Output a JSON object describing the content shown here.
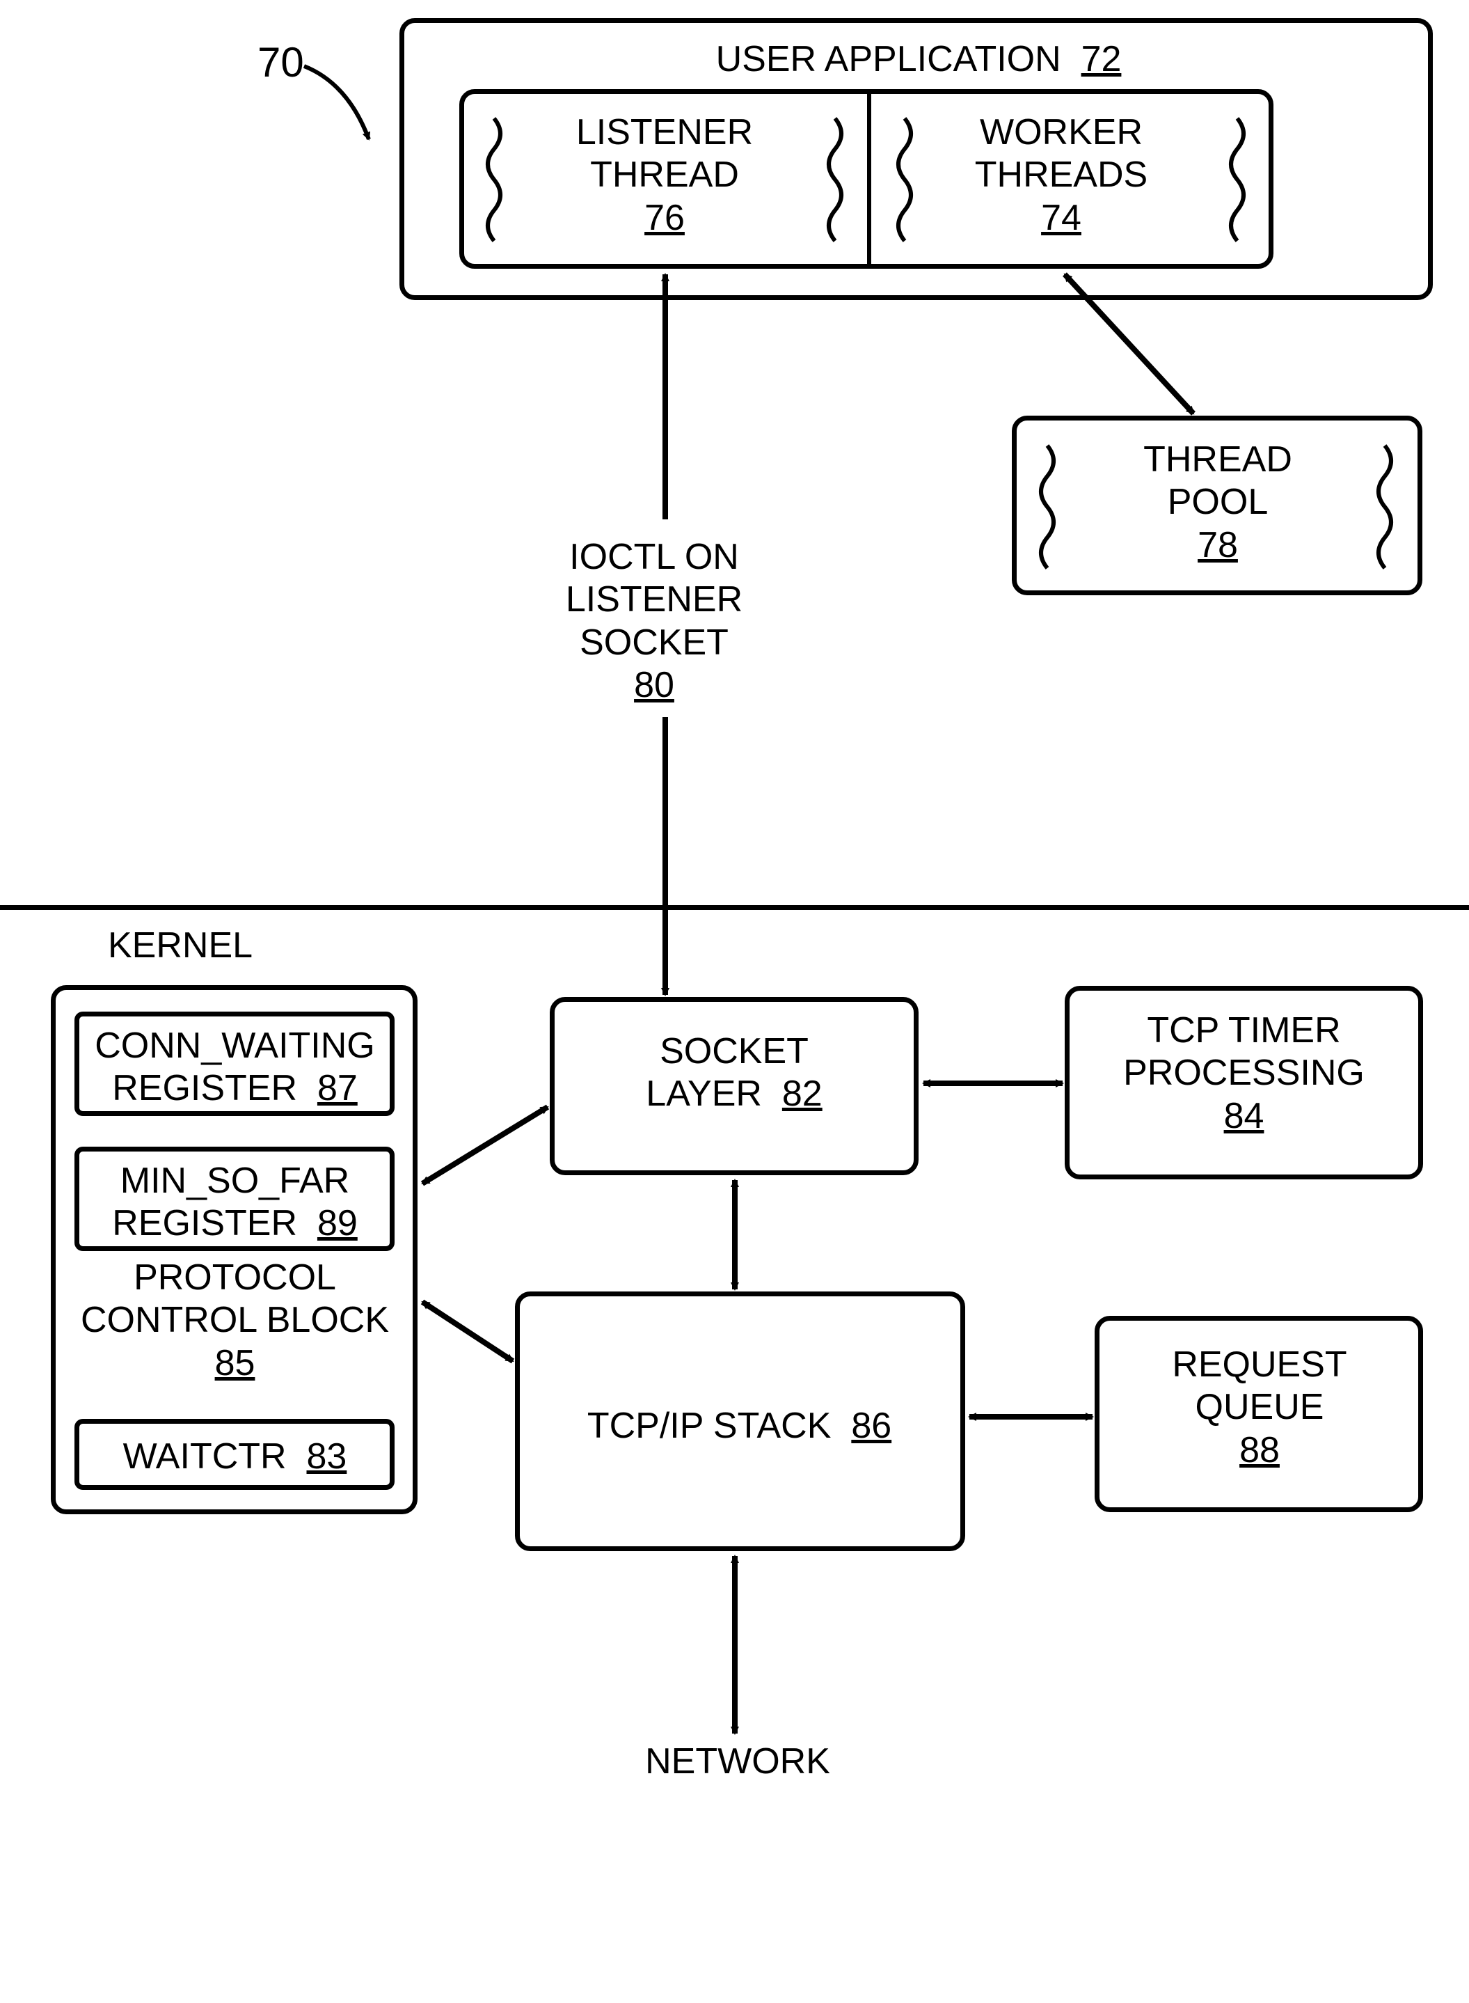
{
  "ref70": "70",
  "userApp": {
    "title": "USER APPLICATION",
    "ref": "72"
  },
  "listener": {
    "l1": "LISTENER",
    "l2": "THREAD",
    "ref": "76"
  },
  "worker": {
    "l1": "WORKER",
    "l2": "THREADS",
    "ref": "74"
  },
  "threadPool": {
    "l1": "THREAD",
    "l2": "POOL",
    "ref": "78"
  },
  "ioctl": {
    "l1": "IOCTL ON",
    "l2": "LISTENER",
    "l3": "SOCKET",
    "ref": "80"
  },
  "kernel": "KERNEL",
  "connWaiting": {
    "l1": "CONN_WAITING",
    "l2": "REGISTER",
    "ref": "87"
  },
  "minSoFar": {
    "l1": "MIN_SO_FAR",
    "l2": "REGISTER",
    "ref": "89"
  },
  "pcb": {
    "l1": "PROTOCOL",
    "l2": "CONTROL BLOCK",
    "ref": "85"
  },
  "waitctr": {
    "label": "WAITCTR",
    "ref": "83"
  },
  "socketLayer": {
    "l1": "SOCKET",
    "l2": "LAYER",
    "ref": "82"
  },
  "tcpTimer": {
    "l1": "TCP TIMER",
    "l2": "PROCESSING",
    "ref": "84"
  },
  "tcpip": {
    "label": "TCP/IP STACK",
    "ref": "86"
  },
  "requestQueue": {
    "l1": "REQUEST",
    "l2": "QUEUE",
    "ref": "88"
  },
  "network": "NETWORK"
}
